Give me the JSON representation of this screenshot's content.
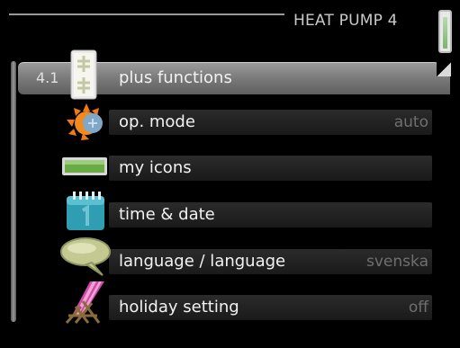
{
  "header": {
    "title": "HEAT PUMP 4"
  },
  "menu": {
    "items": [
      {
        "number": "4.1",
        "label": "plus functions",
        "value": "",
        "icon": "plus-functions-icon",
        "selected": true
      },
      {
        "number": "",
        "label": "op. mode",
        "value": "auto",
        "icon": "sun-icon",
        "selected": false
      },
      {
        "number": "",
        "label": "my icons",
        "value": "",
        "icon": "battery-icon",
        "selected": false
      },
      {
        "number": "",
        "label": "time & date",
        "value": "",
        "icon": "calendar-icon",
        "selected": false
      },
      {
        "number": "",
        "label": "language / language",
        "value": "svenska",
        "icon": "speech-bubble-icon",
        "selected": false
      },
      {
        "number": "",
        "label": "holiday setting",
        "value": "off",
        "icon": "deck-chair-icon",
        "selected": false
      }
    ]
  },
  "colors": {
    "selected_row": "#7c7c7c",
    "row_bar": "#222222",
    "value_text": "#6f6f6f",
    "accent_green": "#79b46b"
  }
}
